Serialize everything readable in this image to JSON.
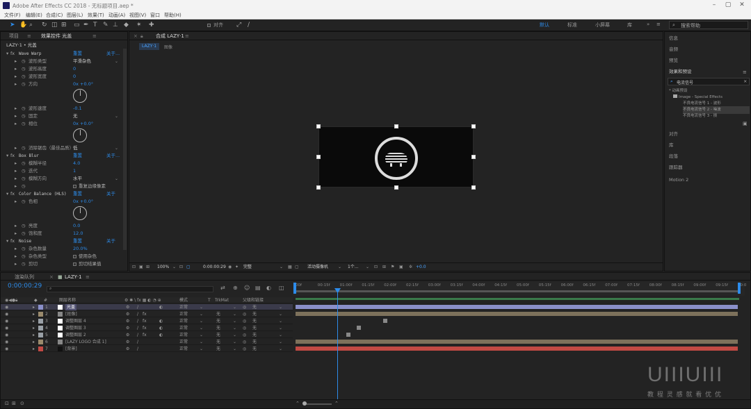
{
  "window": {
    "title": "Adobe After Effects CC 2018 - 无标题项目.aep *"
  },
  "menu": [
    "文件(F)",
    "编辑(E)",
    "合成(C)",
    "图层(L)",
    "效果(T)",
    "动画(A)",
    "视图(V)",
    "窗口",
    "帮助(H)"
  ],
  "toolbar": {
    "snap_label": "对齐",
    "workspaces": [
      "默认",
      "标准",
      "小屏幕",
      "库"
    ],
    "search_placeholder": "搜索帮助"
  },
  "left_panel": {
    "tab_project": "项目",
    "tab_effects": "效果控件 光盖",
    "header": "LAZY·1 • 光盖",
    "effects": [
      {
        "name": "Wave Warp",
        "reset": "重置",
        "about": "关于...",
        "props": [
          {
            "label": "波形类型",
            "value": "平滑杂色"
          },
          {
            "label": "波形高度",
            "value": "0"
          },
          {
            "label": "波形宽度",
            "value": "0"
          },
          {
            "label": "方向",
            "value": "0x +0.0°"
          },
          {
            "label": "波形速度",
            "value": "-0.1"
          },
          {
            "label": "固定",
            "value": "无"
          },
          {
            "label": "相位",
            "value": "0x +0.0°"
          },
          {
            "label": "消除锯齿（最佳品质）",
            "value": "低"
          }
        ]
      },
      {
        "name": "Box Blur",
        "reset": "重置",
        "about": "关于...",
        "props": [
          {
            "label": "模糊半径",
            "value": "4.0"
          },
          {
            "label": "迭代",
            "value": "1"
          },
          {
            "label": "模糊方向",
            "value": "水平"
          },
          {
            "label": "",
            "value": "重复边缘像素"
          }
        ]
      },
      {
        "name": "Color Balance (HLS)",
        "reset": "重置",
        "about": "关于",
        "props": [
          {
            "label": "色相",
            "value": "0x +0.0°"
          },
          {
            "label": "亮度",
            "value": "0.0"
          },
          {
            "label": "饱和度",
            "value": "12.0"
          }
        ]
      },
      {
        "name": "Noise",
        "reset": "重置",
        "about": "关于",
        "props": [
          {
            "label": "杂色数量",
            "value": "20.0%"
          },
          {
            "label": "杂色类型",
            "value": "使用杂色"
          },
          {
            "label": "剪切",
            "value": "剪切结果值"
          }
        ]
      }
    ]
  },
  "composition": {
    "tab": "合成 LAZY·1",
    "subtab": "LAZY·1",
    "crumb": "图像",
    "zoom": "100%",
    "timecode": "0:00:00:29",
    "quality": "完整",
    "camera": "活动摄像机",
    "views": "1个...",
    "exposure": "+0.0"
  },
  "right_panel": {
    "items_top": [
      "信息",
      "音频",
      "预览"
    ],
    "effects_title": "效果和预设",
    "search_value": "电流信号",
    "tree": [
      "* 动画预设",
      "Image - Special Effects",
      "不良电流信号 1 - 波形",
      "不良电流信号 2 - 噪波",
      "不良电流信号 3 - 损"
    ],
    "items_bottom": [
      "对齐",
      "库",
      "段落",
      "跟踪器",
      "Motion 2"
    ]
  },
  "timeline": {
    "tab_render": "渲染队列",
    "tab_comp": "LAZY·1",
    "timecode": "0:00:00:29",
    "col_name": "图层名称",
    "col_mode": "模式",
    "col_trkmat": "TrkMat",
    "col_parent": "父级和链接",
    "layers": [
      {
        "num": "1",
        "name": "光盖",
        "mode": "正常",
        "trk": "",
        "parent": "无",
        "color": "#8a8fc9"
      },
      {
        "num": "2",
        "name": "[抠像]",
        "mode": "正常",
        "trk": "无",
        "parent": "无",
        "color": "#9a8a6c"
      },
      {
        "num": "3",
        "name": "调整图层 4",
        "mode": "正常",
        "trk": "无",
        "parent": "无",
        "color": "#9aa0a6"
      },
      {
        "num": "4",
        "name": "调整图层 3",
        "mode": "正常",
        "trk": "无",
        "parent": "无",
        "color": "#9aa0a6"
      },
      {
        "num": "5",
        "name": "调整图层 2",
        "mode": "正常",
        "trk": "无",
        "parent": "无",
        "color": "#9aa0a6"
      },
      {
        "num": "6",
        "name": "[LAZY LOGO 合成 1]",
        "mode": "正常",
        "trk": "无",
        "parent": "无",
        "color": "#9a8a6c"
      },
      {
        "num": "7",
        "name": "[背景]",
        "mode": "正常",
        "trk": "无",
        "parent": "无",
        "color": "#c24a44"
      }
    ],
    "ruler": [
      "00f",
      "00:15f",
      "01:00f",
      "01:15f",
      "02:00f",
      "02:15f",
      "03:00f",
      "03:15f",
      "04:00f",
      "04:15f",
      "05:00f",
      "05:15f",
      "06:00f",
      "06:15f",
      "07:00f",
      "07:15f",
      "08:00f",
      "08:15f",
      "09:00f",
      "09:15f",
      "10:0"
    ]
  },
  "watermark": {
    "logo": "UIIIUIII",
    "text": "教 程 灵 感 就 看 优 优"
  },
  "colors": {
    "accent": "#2d8ceb",
    "layer_bg": "#8a8fc9",
    "layer_red": "#c24a44",
    "layer_tan": "#9a8a6c"
  }
}
